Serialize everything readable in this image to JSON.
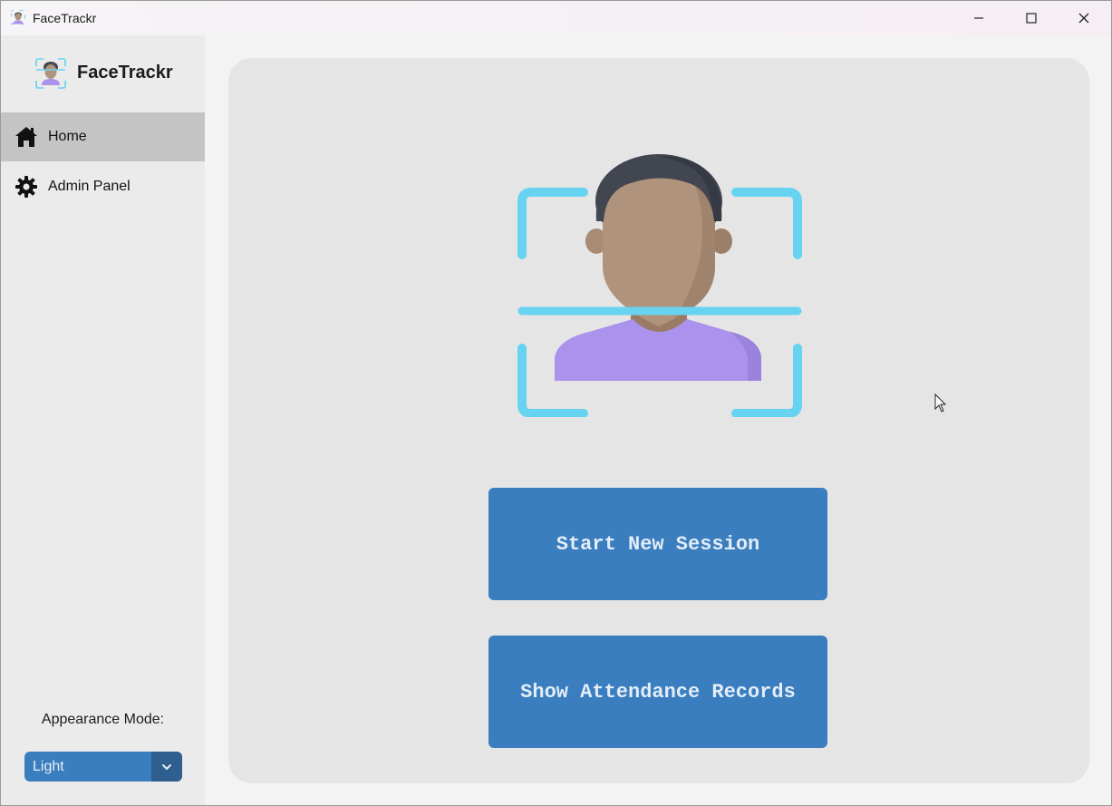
{
  "window": {
    "title": "FaceTrackr",
    "controls": {
      "minimize": "minimize-icon",
      "maximize": "maximize-icon",
      "close": "close-icon"
    }
  },
  "sidebar": {
    "brand": "FaceTrackr",
    "items": [
      {
        "label": "Home",
        "icon": "home-icon",
        "active": true
      },
      {
        "label": "Admin Panel",
        "icon": "gear-icon",
        "active": false
      }
    ],
    "appearance_label": "Appearance Mode:",
    "appearance_value": "Light"
  },
  "main": {
    "hero_icon": "face-scan-icon",
    "buttons": {
      "start": "Start New Session",
      "records": "Show Attendance Records"
    }
  },
  "colors": {
    "accent": "#3a7ebf",
    "accent_dark": "#2e5f8f",
    "scan_frame": "#66d4f1",
    "shirt": "#ab92ec",
    "skin": "#b0937c",
    "hair": "#414651",
    "nav_active": "#c4c4c4"
  }
}
